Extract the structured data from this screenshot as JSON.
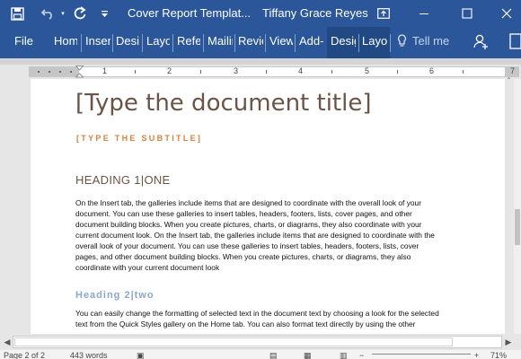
{
  "titlebar": {
    "save_icon": "save-icon",
    "undo_icon": "undo-icon",
    "redo_icon": "redo-icon",
    "qat_menu_icon": "customize-quick-access-icon",
    "document_title": "Cover Report Templat...",
    "user_name": "Tiffany Grace Reyes",
    "ribbon_display_icon": "ribbon-display-options-icon",
    "minimize_icon": "minimize-icon",
    "maximize_icon": "maximize-icon",
    "close_icon": "close-icon"
  },
  "ribbon": {
    "tabs": [
      {
        "label": "File"
      },
      {
        "label": "Home"
      },
      {
        "label": "Insert"
      },
      {
        "label": "Design"
      },
      {
        "label": "Layout"
      },
      {
        "label": "References"
      },
      {
        "label": "Mailings"
      },
      {
        "label": "Review"
      },
      {
        "label": "View"
      },
      {
        "label": "Add-ins"
      },
      {
        "label": "Design"
      },
      {
        "label": "Layout"
      }
    ],
    "tell_me": "Tell me",
    "tell_me_icon": "lightbulb-icon",
    "share_icon": "share-person-icon",
    "colors": {
      "ribbon": "#2b579a",
      "contextual": "#214a85"
    }
  },
  "ruler": {
    "numbers": [
      "1",
      "2",
      "3",
      "4",
      "5",
      "6",
      "7"
    ]
  },
  "document": {
    "title": "[Type the document title]",
    "subtitle": "[TYPE THE SUBTITLE]",
    "heading1": "HEADING 1|ONE",
    "paragraph1": [
      "On the Insert tab, the galleries include items that are designed to coordinate with the overall look of your",
      "document.  You can use these galleries to insert tables, headers, footers, lists, cover pages, and other",
      "document building blocks.  When you create pictures, charts, or diagrams, they also coordinate with your",
      "current document look. On the Insert tab, the galleries include items that are designed to coordinate with the",
      "overall look of your document.  You can use these galleries to insert tables, headers, footers, lists, cover",
      "pages, and other document building blocks.  When you create pictures, charts, or diagrams, they also",
      "coordinate with your current document look"
    ],
    "heading2": "Heading 2|two",
    "paragraph2": [
      "You can easily change the formatting of selected text in the document text by choosing a look for the selected",
      "text from the Quick Styles gallery on the Home tab. You can also format text directly by using the other"
    ],
    "colors": {
      "title": "#6b5446",
      "subtitle": "#d6823d",
      "heading2": "#89a8c8"
    }
  },
  "statusbar": {
    "page": "Page 2 of 2",
    "words": "443 words",
    "zoom": "71%"
  }
}
